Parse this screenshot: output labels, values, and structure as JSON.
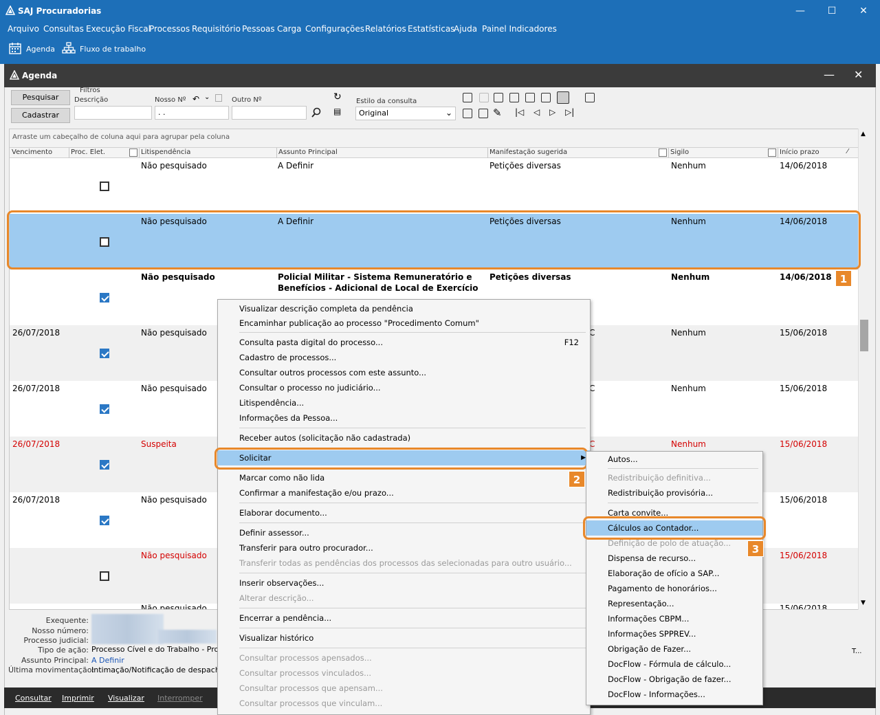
{
  "window": {
    "title": "SAJ Procuradorias"
  },
  "menubar": [
    "Arquivo",
    "Consultas",
    "Execução Fiscal",
    "Processos",
    "Requisitório",
    "Pessoas",
    "Carga",
    "Configurações",
    "Relatórios",
    "Estatísticas",
    "Ajuda",
    "Painel Indicadores"
  ],
  "toolbar": {
    "agenda": "Agenda",
    "fluxo": "Fluxo de trabalho"
  },
  "agenda": {
    "title": "Agenda"
  },
  "search": {
    "pesquisar": "Pesquisar",
    "cadastrar": "Cadastrar",
    "filtros": "Filtros",
    "descricao": "Descrição",
    "nosso_no": "Nosso Nº",
    "nosso_no_value": ". .",
    "outro_no": "Outro Nº",
    "estilo": "Estilo da consulta",
    "estilo_value": "Original"
  },
  "grid": {
    "group_hint": "Arraste um cabeçalho de coluna aqui para agrupar pela coluna",
    "columns": [
      "Vencimento",
      "Proc. Elet.",
      "Litispendência",
      "Assunto Principal",
      "Manifestação sugerida",
      "Sigilo",
      "Início prazo"
    ],
    "rows": [
      {
        "venc": "",
        "lit": "Não pesquisado",
        "assunto": "A Definir",
        "assunto2": "",
        "manif": "Petições diversas",
        "sigilo": "Nenhum",
        "inicio": "14/06/2018",
        "checked": false,
        "red": false,
        "bold": false
      },
      {
        "venc": "",
        "lit": "Não pesquisado",
        "assunto": "A Definir",
        "assunto2": "",
        "manif": "Petições diversas",
        "sigilo": "Nenhum",
        "inicio": "14/06/2018",
        "checked": false,
        "red": false,
        "bold": false
      },
      {
        "venc": "",
        "lit": "Não pesquisado",
        "assunto": "Policial Militar - Sistema Remuneratório e",
        "assunto2": "Benefícios - Adicional de Local de Exercício",
        "manif": "Petições diversas",
        "sigilo": "Nenhum",
        "inicio": "14/06/2018",
        "checked": true,
        "red": false,
        "bold": true
      },
      {
        "venc": "26/07/2018",
        "lit": "Não pesquisado",
        "assunto": "",
        "assunto2": "",
        "manif": "C",
        "sigilo": "Nenhum",
        "inicio": "15/06/2018",
        "checked": true,
        "red": false,
        "bold": false
      },
      {
        "venc": "26/07/2018",
        "lit": "Não pesquisado",
        "assunto": "",
        "assunto2": "",
        "manif": "C",
        "sigilo": "Nenhum",
        "inicio": "15/06/2018",
        "checked": true,
        "red": false,
        "bold": false
      },
      {
        "venc": "26/07/2018",
        "lit": "Suspeita",
        "assunto": "",
        "assunto2": "",
        "manif": "C",
        "sigilo": "Nenhum",
        "inicio": "15/06/2018",
        "checked": true,
        "red": true,
        "bold": false
      },
      {
        "venc": "26/07/2018",
        "lit": "Não pesquisado",
        "assunto": "",
        "assunto2": "",
        "manif": "",
        "sigilo": "",
        "inicio": "15/06/2018",
        "checked": true,
        "red": false,
        "bold": false
      },
      {
        "venc": "",
        "lit": "Não pesquisado",
        "assunto": "",
        "assunto2": "",
        "manif": "",
        "sigilo": "",
        "inicio": "15/06/2018",
        "checked": false,
        "red": true,
        "bold": false
      }
    ],
    "partial_row": {
      "lit": "Não pesquisado",
      "inicio": "15/06/2018"
    }
  },
  "details": {
    "exequente": "Exequente:",
    "nosso_numero": "Nosso número:",
    "processo_judicial": "Processo judicial:",
    "tipo_acao": "Tipo de ação:",
    "tipo_acao_value": "Processo Cível e do Trabalho - Proce",
    "assunto_principal": "Assunto Principal:",
    "assunto_principal_value": "A Definir",
    "ultima_mov": "Última movimentação:",
    "ultima_mov_value": "Intimação/Notificação de despacho",
    "trailing": "T..."
  },
  "bottombar": [
    "Consultar",
    "Imprimir",
    "Visualizar",
    "Interromper"
  ],
  "context_menu": [
    {
      "label": "Visualizar descrição completa da pendência",
      "disabled": false
    },
    {
      "label": "Encaminhar publicação ao processo \"Procedimento Comum\"",
      "disabled": false
    },
    {
      "label": "Consulta pasta digital do processo...",
      "shortcut": "F12",
      "disabled": false
    },
    {
      "label": "Cadastro de processos...",
      "disabled": false
    },
    {
      "label": "Consultar outros processos com este assunto...",
      "disabled": false
    },
    {
      "label": "Consultar o processo no judiciário...",
      "disabled": false
    },
    {
      "label": "Litispendência...",
      "disabled": false
    },
    {
      "label": "Informações da Pessoa...",
      "disabled": false
    },
    {
      "label": "Receber autos (solicitação não cadastrada)",
      "disabled": false
    },
    {
      "label": "Solicitar",
      "disabled": false
    },
    {
      "label": "Marcar como não lida",
      "disabled": false
    },
    {
      "label": "Confirmar a manifestação e/ou prazo...",
      "disabled": false
    },
    {
      "label": "Elaborar documento...",
      "disabled": false
    },
    {
      "label": "Definir assessor...",
      "disabled": false
    },
    {
      "label": "Transferir para outro procurador...",
      "disabled": false
    },
    {
      "label": "Transferir todas as pendências dos processos das selecionadas para outro usuário...",
      "disabled": true
    },
    {
      "label": "Inserir observações...",
      "disabled": false
    },
    {
      "label": "Alterar descrição...",
      "disabled": true
    },
    {
      "label": "Encerrar a pendência...",
      "disabled": false
    },
    {
      "label": "Visualizar histórico",
      "disabled": false
    },
    {
      "label": "Consultar processos apensados...",
      "disabled": true
    },
    {
      "label": "Consultar processos vinculados...",
      "disabled": true
    },
    {
      "label": "Consultar processos que apensam...",
      "disabled": true
    },
    {
      "label": "Consultar processos que vinculam...",
      "disabled": true
    }
  ],
  "submenu": [
    {
      "label": "Autos...",
      "disabled": false
    },
    {
      "label": "Redistribuição definitiva...",
      "disabled": true
    },
    {
      "label": "Redistribuição provisória...",
      "disabled": false
    },
    {
      "label": "Carta convite...",
      "disabled": false
    },
    {
      "label": "Cálculos ao Contador...",
      "disabled": false
    },
    {
      "label": "Definição de polo de atuação...",
      "disabled": true
    },
    {
      "label": "Dispensa de recurso...",
      "disabled": false
    },
    {
      "label": "Elaboração de ofício a SAP...",
      "disabled": false
    },
    {
      "label": "Pagamento de honorários...",
      "disabled": false
    },
    {
      "label": "Representação...",
      "disabled": false
    },
    {
      "label": "Informações CBPM...",
      "disabled": false
    },
    {
      "label": "Informações SPPREV...",
      "disabled": false
    },
    {
      "label": "Obrigação de Fazer...",
      "disabled": false
    },
    {
      "label": "DocFlow - Fórmula de cálculo...",
      "disabled": false
    },
    {
      "label": "DocFlow - Obrigação de fazer...",
      "disabled": false
    },
    {
      "label": "DocFlow - Informações...",
      "disabled": false
    }
  ],
  "badges": [
    "1",
    "2",
    "3"
  ],
  "colors": {
    "accent": "#1d6fb8",
    "highlight": "#e8882a",
    "selected_row": "#9ecbf0",
    "danger": "#d40000"
  }
}
